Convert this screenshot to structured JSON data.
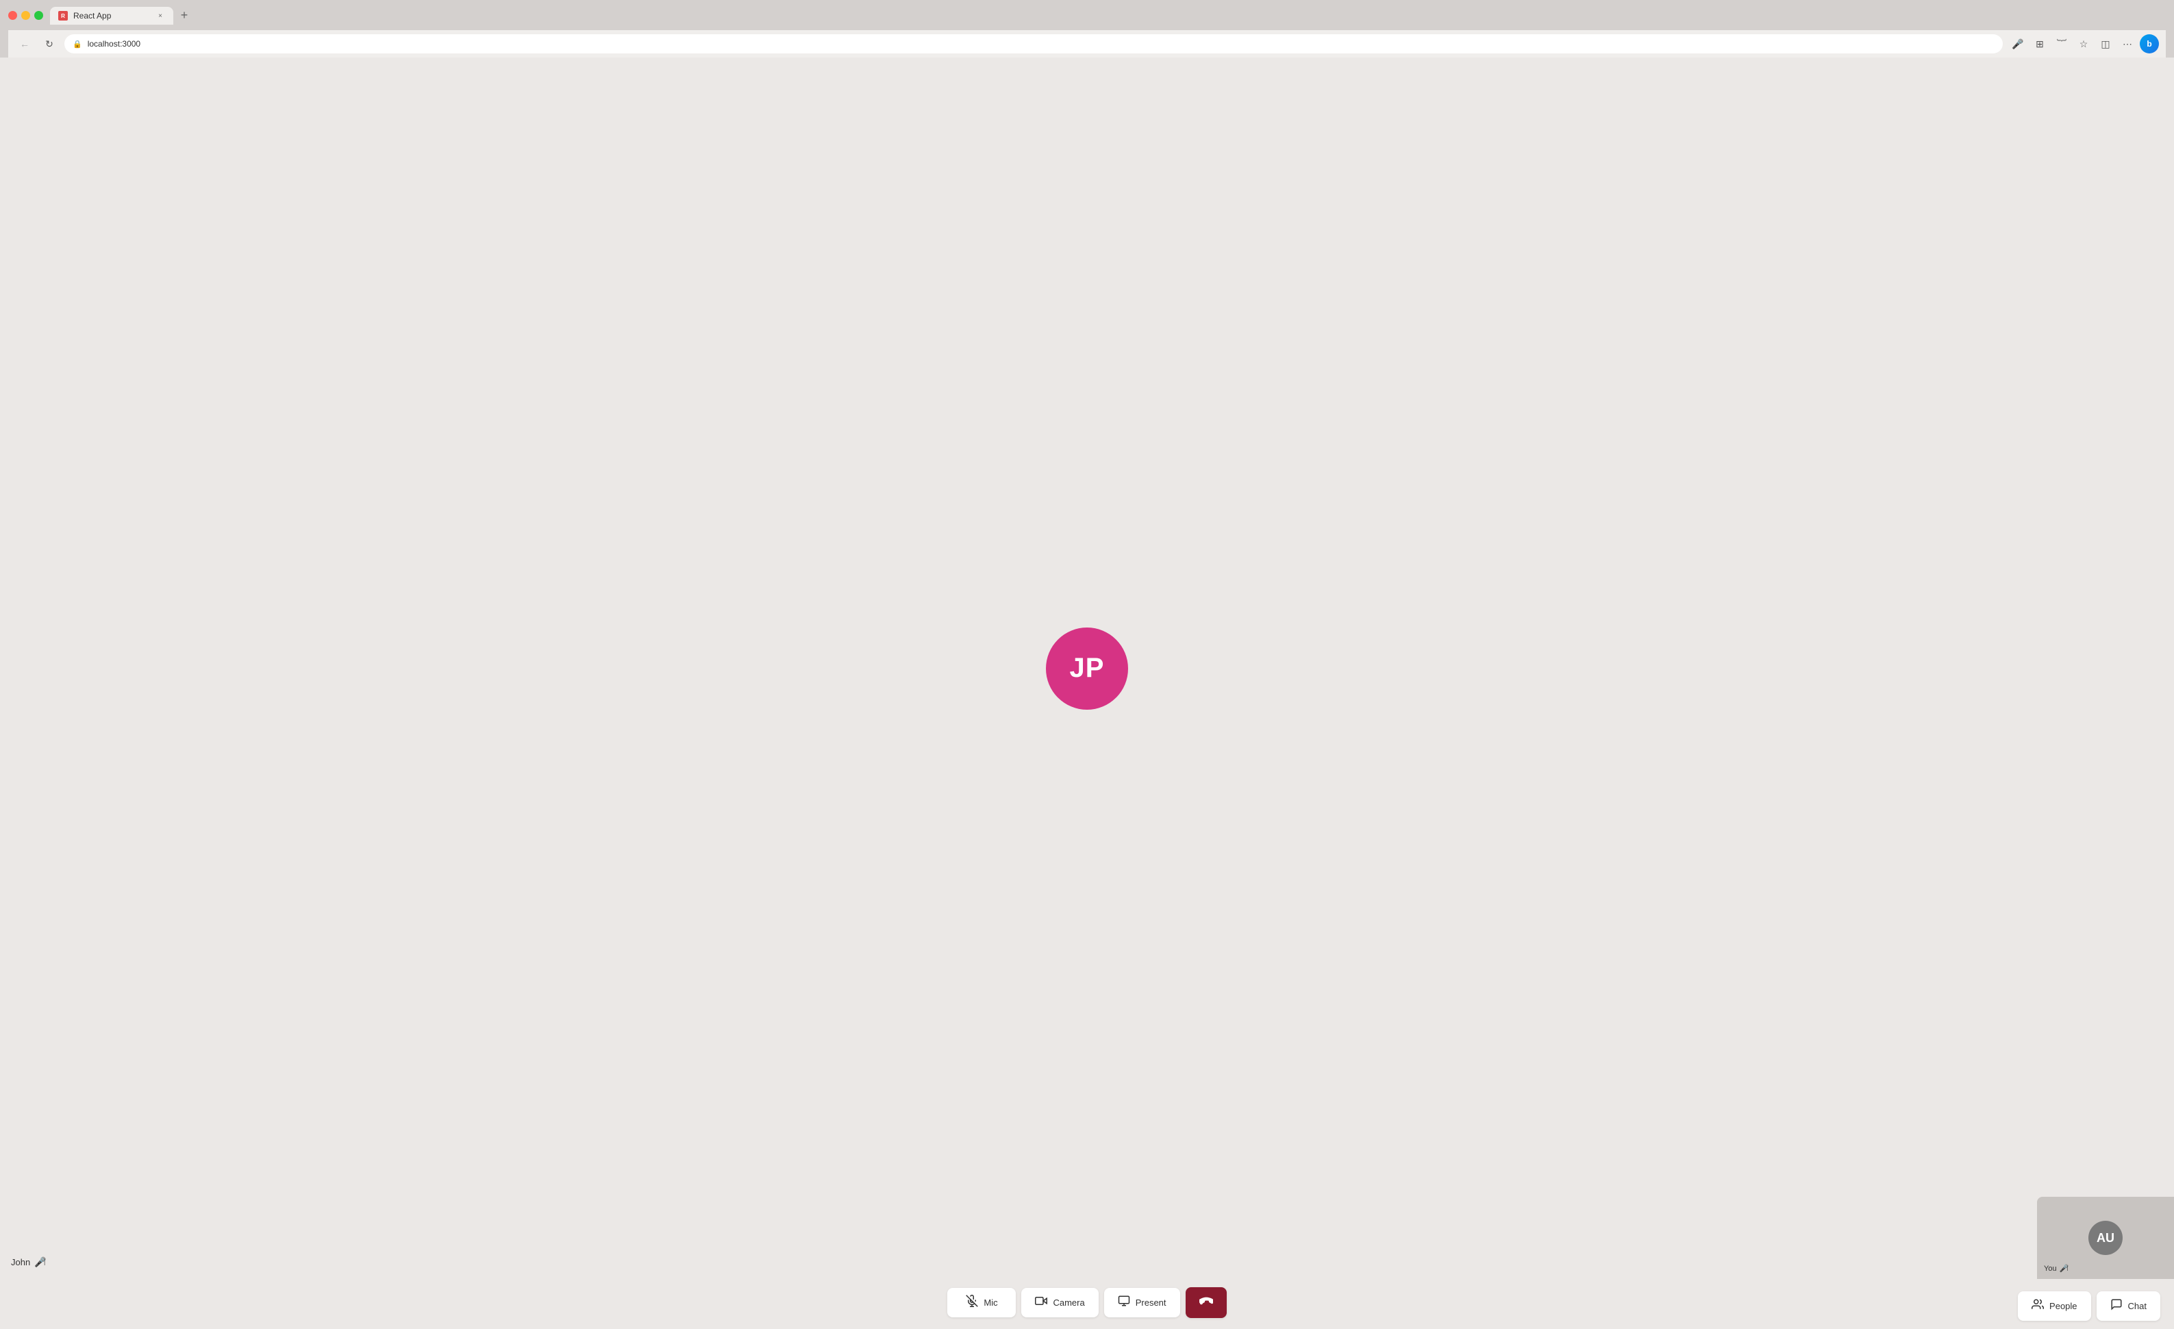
{
  "browser": {
    "tab_title": "React App",
    "tab_favicon": "R",
    "url": "localhost:3000",
    "close_label": "×",
    "new_tab_label": "+"
  },
  "meeting": {
    "main_participant_initials": "JP",
    "main_participant_name": "John",
    "self_initials": "AU",
    "self_label": "You"
  },
  "controls": {
    "mic_label": "Mic",
    "camera_label": "Camera",
    "present_label": "Present",
    "people_label": "People",
    "chat_label": "Chat"
  },
  "icons": {
    "mic_off": "🎤",
    "camera": "📹",
    "present": "🖥",
    "phone_end": "📞",
    "people": "👥",
    "chat": "💬"
  }
}
